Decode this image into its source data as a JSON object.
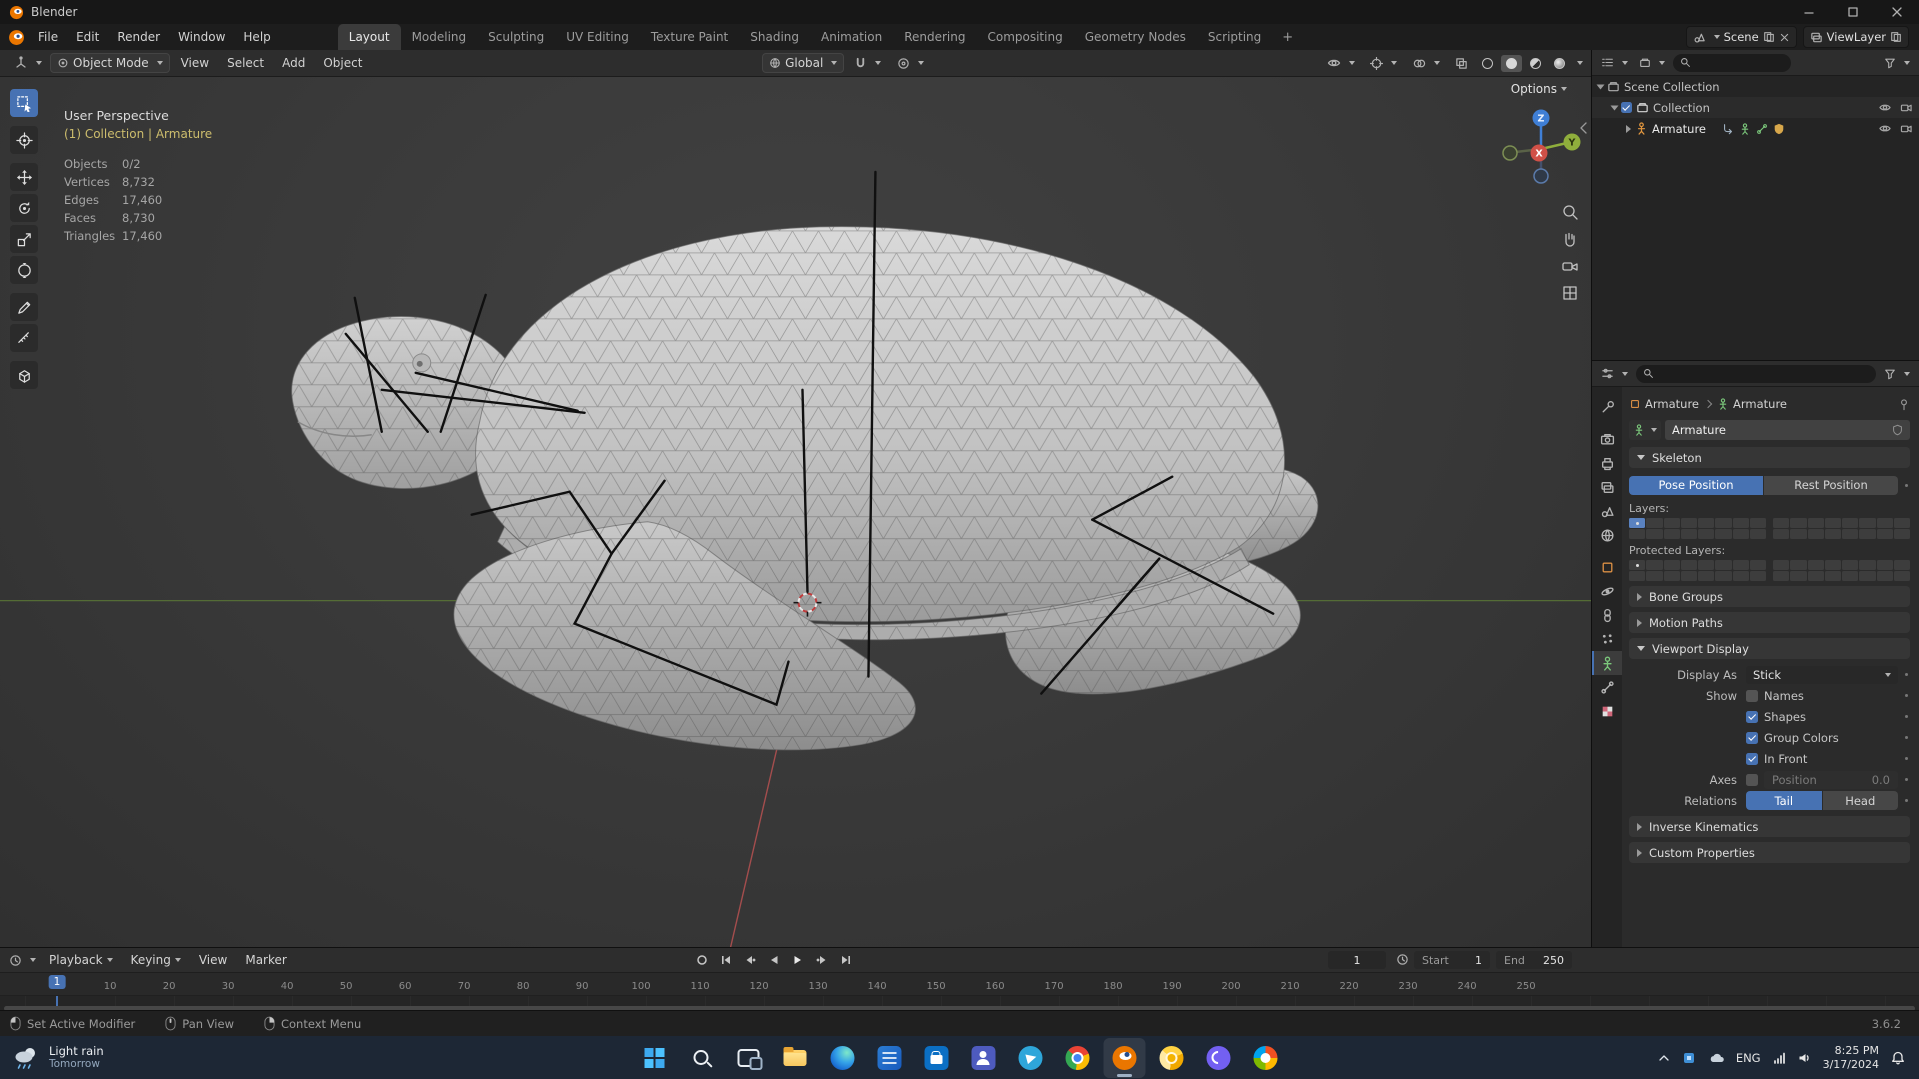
{
  "colors": {
    "accent_blue": "#4772b3",
    "blender_orange": "#ea7600",
    "axis_x": "#d05047",
    "axis_y": "#8fae3c",
    "axis_z": "#3f7fd6",
    "active_object_text": "#cdbd6d"
  },
  "icons": {
    "search-icon": "magnifier-glass",
    "filter-icon": "funnel",
    "eye-icon": "open-eye",
    "camera-icon": "camera-body",
    "clock-icon": "clock-face",
    "pin-icon": "pushpin",
    "magnet-icon": "snap-magnet",
    "zoom-icon": "magnifier",
    "hand-icon": "pan-hand",
    "grid-icon": "orthographic-grid"
  },
  "window": {
    "title": "Blender"
  },
  "topbar": {
    "menus": [
      "File",
      "Edit",
      "Render",
      "Window",
      "Help"
    ],
    "tabs": [
      "Layout",
      "Modeling",
      "Sculpting",
      "UV Editing",
      "Texture Paint",
      "Shading",
      "Animation",
      "Rendering",
      "Compositing",
      "Geometry Nodes",
      "Scripting"
    ],
    "active_tab": "Layout",
    "add_tab": "+",
    "scene_label": "Scene",
    "viewlayer_label": "ViewLayer"
  },
  "viewport_header": {
    "mode": "Object Mode",
    "menus": [
      "View",
      "Select",
      "Add",
      "Object"
    ],
    "orientation": "Global",
    "options_label": "Options"
  },
  "viewport": {
    "view_label": "User Perspective",
    "context_label": "(1) Collection | Armature",
    "stats": [
      {
        "label": "Objects",
        "value": "0/2"
      },
      {
        "label": "Vertices",
        "value": "8,732"
      },
      {
        "label": "Edges",
        "value": "17,460"
      },
      {
        "label": "Faces",
        "value": "8,730"
      },
      {
        "label": "Triangles",
        "value": "17,460"
      }
    ],
    "axis_labels": {
      "x": "X",
      "y": "Y",
      "z": "Z"
    }
  },
  "outliner": {
    "rows": [
      {
        "label": "Scene Collection"
      },
      {
        "label": "Collection"
      },
      {
        "label": "Armature"
      }
    ]
  },
  "properties": {
    "breadcrumb": {
      "object": "Armature",
      "data": "Armature"
    },
    "name_value": "Armature",
    "skeleton": {
      "title": "Skeleton",
      "pose_btn": "Pose Position",
      "rest_btn": "Rest Position",
      "layers_label": "Layers:",
      "protected_label": "Protected Layers:"
    },
    "sections_collapsed_top": [
      "Bone Groups",
      "Motion Paths"
    ],
    "viewport_display": {
      "title": "Viewport Display",
      "display_as_label": "Display As",
      "display_as_value": "Stick",
      "show_label": "Show",
      "toggles": [
        {
          "label": "Names",
          "checked": false
        },
        {
          "label": "Shapes",
          "checked": true
        },
        {
          "label": "Group Colors",
          "checked": true
        },
        {
          "label": "In Front",
          "checked": true
        }
      ],
      "axes_label": "Axes",
      "position_label": "Position",
      "position_value": "0.0",
      "relations_label": "Relations",
      "tail_btn": "Tail",
      "head_btn": "Head"
    },
    "sections_collapsed_bottom": [
      "Inverse Kinematics",
      "Custom Properties"
    ]
  },
  "timeline": {
    "menus": [
      "Playback",
      "Keying",
      "View",
      "Marker"
    ],
    "current_frame": "1",
    "start_label": "Start",
    "start_value": "1",
    "end_label": "End",
    "end_value": "250",
    "ruler": {
      "marks": [
        10,
        20,
        30,
        40,
        50,
        60,
        70,
        80,
        90,
        100,
        110,
        120,
        130,
        140,
        150,
        160,
        170,
        180,
        190,
        200,
        210,
        220,
        230,
        240,
        250
      ]
    }
  },
  "statusbar": {
    "hints": [
      "Set Active Modifier",
      "Pan View",
      "Context Menu"
    ],
    "version": "3.6.2"
  },
  "taskbar": {
    "weather_line1": "Light rain",
    "weather_line2": "Tomorrow",
    "apps": [
      "windows-start",
      "search",
      "task-view",
      "file-explorer",
      "edge",
      "word",
      "store",
      "teams",
      "telegram",
      "chrome",
      "blender",
      "chrome-canary",
      "viber",
      "photos"
    ],
    "active_app": "blender",
    "tray": {
      "language": "ENG",
      "time": "8:25 PM",
      "date": "3/17/2024"
    }
  }
}
